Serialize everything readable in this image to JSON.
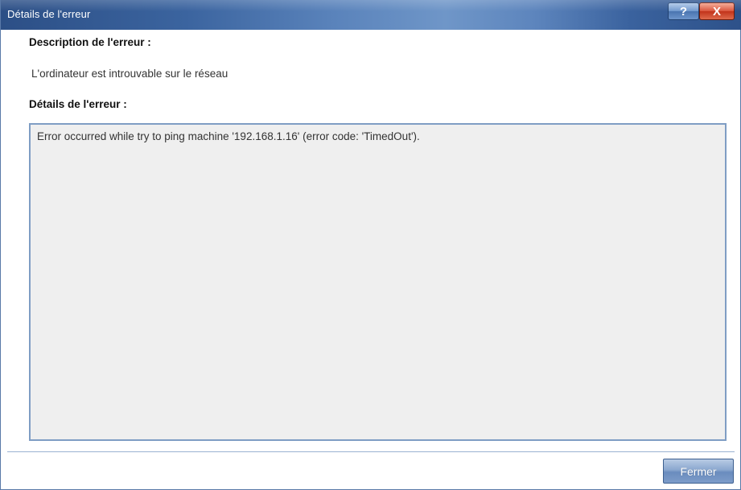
{
  "window": {
    "title": "Détails de l'erreur",
    "help_label": "?",
    "close_label": "X"
  },
  "main": {
    "description_heading": "Description de l'erreur :",
    "description_value": "L'ordinateur est introuvable sur le réseau",
    "details_heading": "Détails de l'erreur :",
    "details_value": "Error occurred while try to ping machine '192.168.1.16' (error code: 'TimedOut')."
  },
  "footer": {
    "close_button_label": "Fermer"
  },
  "colors": {
    "titlebar": "#3b649f",
    "accent_border": "#7f9dc4",
    "close_button": "#c2331a",
    "details_background": "#efefef"
  }
}
